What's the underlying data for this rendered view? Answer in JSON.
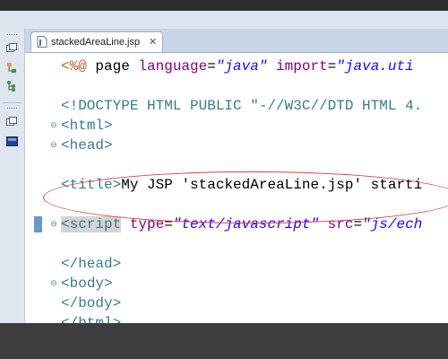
{
  "editor": {
    "tab": {
      "label": "stackedAreaLine.jsp",
      "close": "✕"
    },
    "lines": [
      {
        "segments": [
          {
            "t": "<%@ ",
            "c": "dir"
          },
          {
            "t": "page ",
            "c": "plain"
          },
          {
            "t": "language",
            "c": "attr"
          },
          {
            "t": "=",
            "c": "plain"
          },
          {
            "t": "\"java\"",
            "c": "val"
          },
          {
            "t": " import",
            "c": "attr"
          },
          {
            "t": "=",
            "c": "plain"
          },
          {
            "t": "\"java.uti",
            "c": "val"
          }
        ]
      },
      {
        "segments": []
      },
      {
        "segments": [
          {
            "t": "<!DOCTYPE ",
            "c": "tag"
          },
          {
            "t": "HTML PUBLIC ",
            "c": "tag"
          },
          {
            "t": "\"-//W3C//DTD HTML 4.",
            "c": "tag"
          }
        ]
      },
      {
        "segments": [
          {
            "t": "<",
            "c": "tag"
          },
          {
            "t": "html",
            "c": "tag"
          },
          {
            "t": ">",
            "c": "tag"
          }
        ]
      },
      {
        "segments": [
          {
            "t": "<",
            "c": "tag"
          },
          {
            "t": "head",
            "c": "tag"
          },
          {
            "t": ">",
            "c": "tag"
          }
        ]
      },
      {
        "segments": []
      },
      {
        "segments": [
          {
            "t": "<",
            "c": "tag"
          },
          {
            "t": "title",
            "c": "tag"
          },
          {
            "t": ">",
            "c": "tag"
          },
          {
            "t": "My JSP 'stackedAreaLine.jsp' starti",
            "c": "plain"
          }
        ]
      },
      {
        "segments": []
      },
      {
        "segments": [
          {
            "t": "<script",
            "c": "tag",
            "sel": true
          },
          {
            "t": " type",
            "c": "attr"
          },
          {
            "t": "=",
            "c": "plain"
          },
          {
            "t": "\"text/javascript\"",
            "c": "val"
          },
          {
            "t": " src",
            "c": "attr"
          },
          {
            "t": "=",
            "c": "plain"
          },
          {
            "t": "\"js/ech",
            "c": "val"
          }
        ]
      },
      {
        "segments": []
      },
      {
        "segments": [
          {
            "t": "</",
            "c": "tag"
          },
          {
            "t": "head",
            "c": "tag"
          },
          {
            "t": ">",
            "c": "tag"
          }
        ]
      },
      {
        "segments": [
          {
            "t": "<",
            "c": "tag"
          },
          {
            "t": "body",
            "c": "tag"
          },
          {
            "t": ">",
            "c": "tag"
          }
        ]
      },
      {
        "segments": [
          {
            "t": "</",
            "c": "tag"
          },
          {
            "t": "body",
            "c": "tag"
          },
          {
            "t": ">",
            "c": "tag"
          }
        ]
      },
      {
        "segments": [
          {
            "t": "</",
            "c": "tag"
          },
          {
            "t": "html",
            "c": "tag"
          },
          {
            "t": ">",
            "c": "tag"
          }
        ]
      }
    ]
  },
  "colors": {
    "tag": "#3b7a8a",
    "attribute": "#7f007f",
    "value": "#2a00ff",
    "directive": "#bf5f3f",
    "annotation": "#d94040",
    "marker": "#6b98c8"
  },
  "leftbar": {
    "icons": [
      "restore-icon",
      "hierarchy-icon",
      "outline-icon",
      "restore-icon-2",
      "console-icon"
    ]
  }
}
